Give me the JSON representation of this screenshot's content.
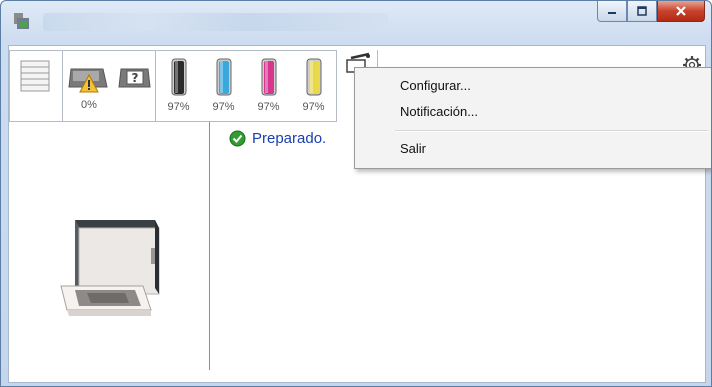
{
  "window": {
    "title": "",
    "colors": {
      "accent": "#1a3fb0",
      "close_button": "#c7422c",
      "ok_green": "#2f9d2f"
    }
  },
  "caption_buttons": [
    {
      "name": "minimize",
      "icon": "minimize-icon"
    },
    {
      "name": "maximize",
      "icon": "maximize-icon"
    },
    {
      "name": "close",
      "icon": "close-icon"
    }
  ],
  "toolbar": {
    "paper": {
      "icon": "paper-stack-icon",
      "label": ""
    },
    "tray": {
      "icon": "tray-warning-icon",
      "label": "0%",
      "level": 0
    },
    "unknown": {
      "icon": "question-icon"
    },
    "toners": [
      {
        "name": "black",
        "color": "#2b2b2b",
        "label": "97%",
        "level": 0.97
      },
      {
        "name": "cyan",
        "color": "#3aa7dd",
        "label": "97%",
        "level": 0.97
      },
      {
        "name": "magenta",
        "color": "#d6368f",
        "label": "97%",
        "level": 0.97
      },
      {
        "name": "yellow",
        "color": "#e8d84a",
        "label": "97%",
        "level": 0.97
      }
    ],
    "tool": {
      "icon": "tool-menu-icon"
    },
    "settings": {
      "icon": "gear-icon"
    }
  },
  "status": {
    "icon": "check-circle-icon",
    "text": "Preparado."
  },
  "context_menu": {
    "items": [
      {
        "label": "Configurar..."
      },
      {
        "label": "Notificación..."
      },
      {
        "label": "Salir"
      }
    ]
  }
}
